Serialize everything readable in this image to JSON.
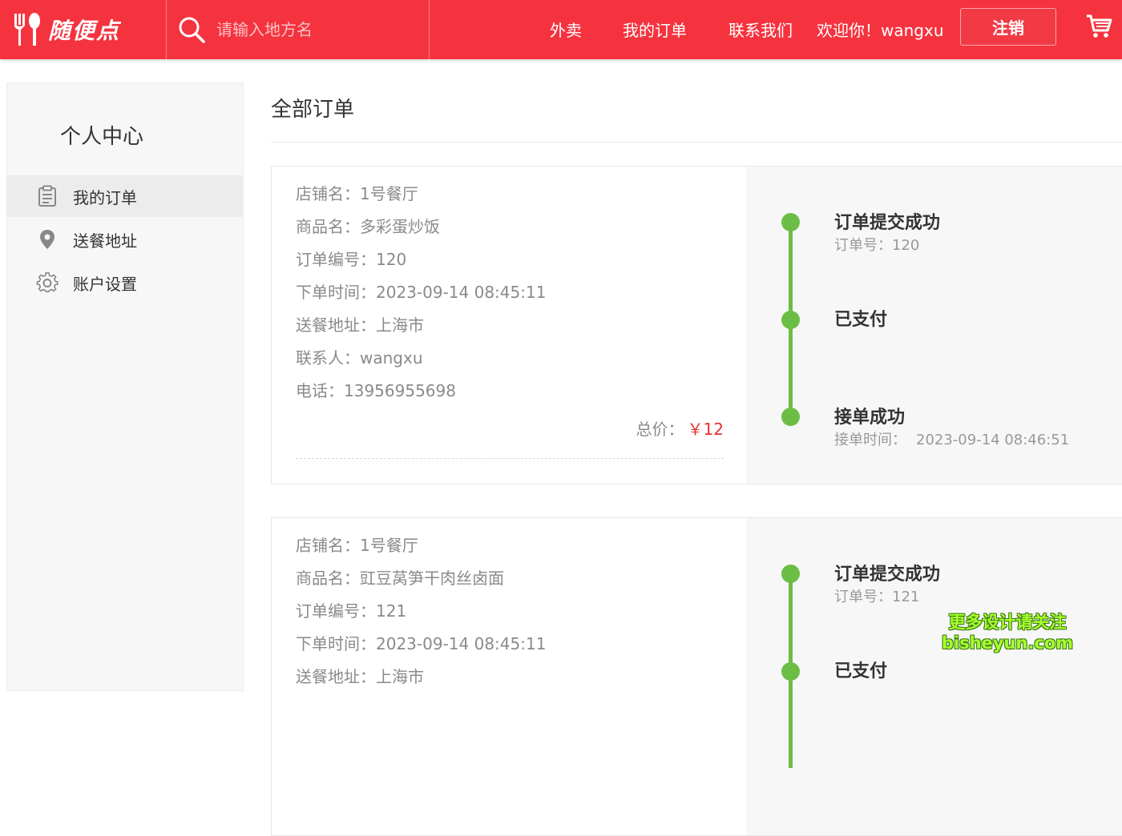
{
  "header": {
    "logo_text": "随便点",
    "search_placeholder": "请输入地方名",
    "nav": [
      "外卖",
      "我的订单",
      "联系我们"
    ],
    "welcome": "欢迎你！wangxu",
    "logout_label": "注销",
    "brand_color": "#f5333f"
  },
  "sidebar": {
    "title": "个人中心",
    "items": [
      {
        "label": "我的订单",
        "icon": "clipboard-icon",
        "active": true
      },
      {
        "label": "送餐地址",
        "icon": "location-pin-icon",
        "active": false
      },
      {
        "label": "账户设置",
        "icon": "gear-icon",
        "active": false
      }
    ]
  },
  "main": {
    "title": "全部订单",
    "orders": [
      {
        "shop_label": "店铺名：",
        "shop": "1号餐厅",
        "product_label": "商品名：",
        "product": "多彩蛋炒饭",
        "order_no_label": "订单编号：",
        "order_no": "120",
        "time_label": "下单时间：",
        "time": "2023-09-14 08:45:11",
        "address_label": "送餐地址：",
        "address": "上海市",
        "contact_label": "联系人：",
        "contact": "wangxu",
        "phone_label": "电话：",
        "phone": "13956955698",
        "total_label": "总价：",
        "total": "￥12",
        "timeline": {
          "submitted": "订单提交成功",
          "submitted_sub": "订单号：120",
          "paid": "已支付",
          "accepted": "接单成功",
          "accepted_sub_label": "接单时间：",
          "accepted_sub": "2023-09-14 08:46:51"
        }
      },
      {
        "shop_label": "店铺名：",
        "shop": "1号餐厅",
        "product_label": "商品名：",
        "product": "豇豆莴笋干肉丝卤面",
        "order_no_label": "订单编号：",
        "order_no": "121",
        "time_label": "下单时间：",
        "time": "2023-09-14 08:45:11",
        "address_label": "送餐地址：",
        "address": "上海市",
        "timeline": {
          "submitted": "订单提交成功",
          "submitted_sub": "订单号：121",
          "paid": "已支付"
        }
      }
    ]
  },
  "watermark": {
    "line1": "更多设计请关注",
    "line2": "bisheyun.com"
  },
  "colors": {
    "accent": "#f5333f",
    "timeline": "#6cbd45",
    "price": "#e63232",
    "watermark": "#a6ff2e"
  }
}
